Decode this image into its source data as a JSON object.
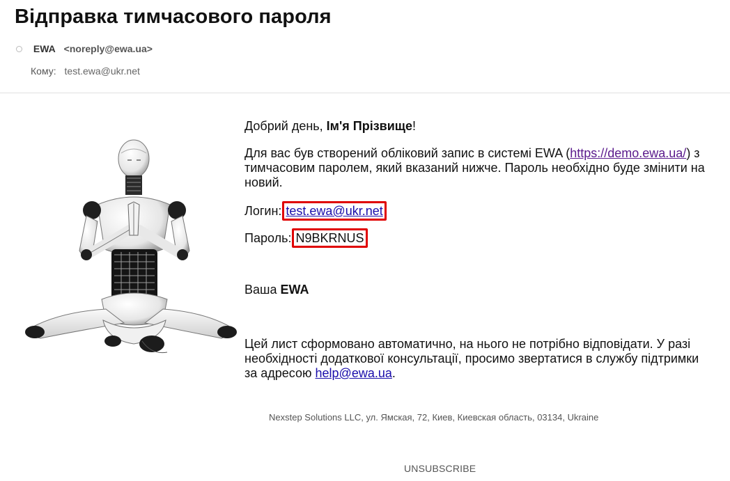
{
  "email": {
    "subject": "Відправка тимчасового пароля",
    "from_name": "EWA",
    "from_email": "<noreply@ewa.ua>",
    "to_label": "Кому:",
    "to_value": "test.ewa@ukr.net"
  },
  "content": {
    "greeting_prefix": "Добрий день, ",
    "greeting_name": "Ім'я Прізвище",
    "greeting_suffix": "!",
    "intro_before": "Для вас був створений обліковий запис в системі EWA (",
    "intro_link": "https://demo.ewa.ua/",
    "intro_after": ") з тимчасовим паролем, який вказаний нижче. Пароль необхідно буде змінити на новий.",
    "login_label": "Логин:",
    "login_value": "test.ewa@ukr.net",
    "password_label": "Пароль:",
    "password_value": "N9BKRNUS",
    "sign_prefix": "Ваша ",
    "sign_brand": "EWA",
    "auto_before": "Цей лист сформовано автоматично, на нього не потрібно відповідати. У разі необхідності додаткової консультації, просимо звертатися в службу підтримки за адресою ",
    "help_email": "help@ewa.ua",
    "auto_after": "."
  },
  "footer": {
    "address": "Nexstep Solutions LLC, ул. Ямская, 72, Киев, Киевская область, 03134, Ukraine",
    "unsubscribe": "UNSUBSCRIBE"
  },
  "colors": {
    "highlight_border": "#e00000",
    "link": "#1a0dab",
    "visited_link": "#5a1a8c"
  },
  "icons": {
    "sender_status": "status-dot-icon"
  }
}
